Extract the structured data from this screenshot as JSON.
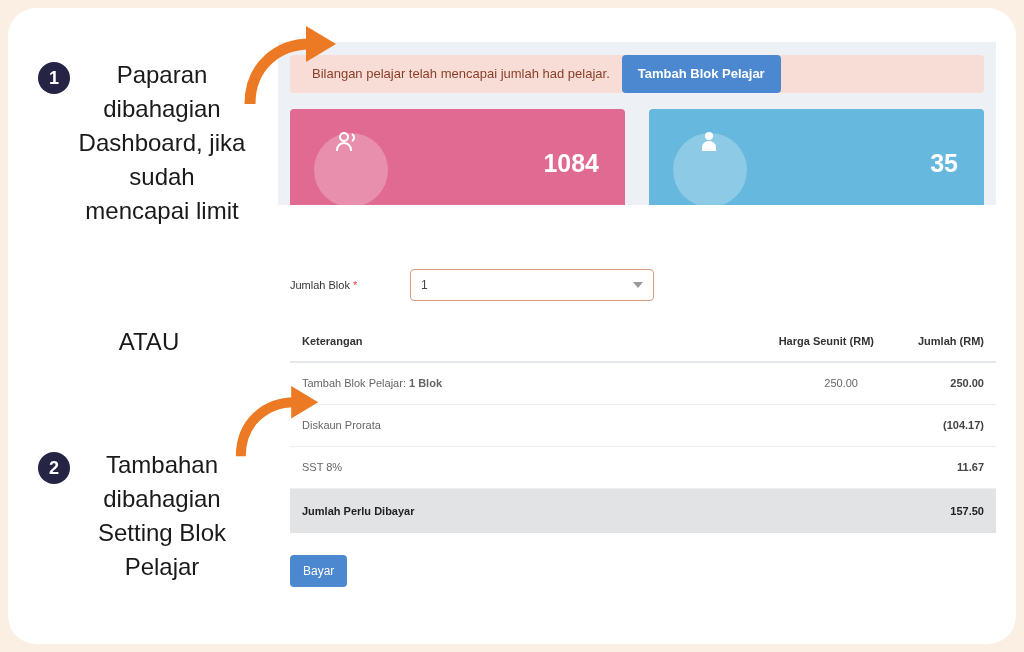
{
  "steps": [
    {
      "number": "1",
      "caption": "Paparan dibahagian Dashboard, jika sudah mencapai limit"
    },
    {
      "number": "2",
      "caption": "Tambahan dibahagian Setting Blok Pelajar"
    }
  ],
  "separator": "ATAU",
  "dashboard": {
    "alert": {
      "message": "Bilangan pelajar telah mencapai jumlah had pelajar.",
      "button": "Tambah Blok Pelajar"
    },
    "stats": [
      {
        "value": "1084",
        "color": "#e06a92"
      },
      {
        "value": "35",
        "color": "#66b8de"
      }
    ]
  },
  "form": {
    "field": {
      "label": "Jumlah Blok",
      "required_mark": "*",
      "value": "1"
    },
    "table": {
      "columns": [
        "Keterangan",
        "Harga Seunit (RM)",
        "Jumlah (RM)"
      ],
      "rows": [
        {
          "description": "Tambah Blok Pelajar: **1 Blok**",
          "unit_price": "250.00",
          "amount": "250.00",
          "total": false
        },
        {
          "description": "Diskaun Prorata",
          "amount": "(104.17)",
          "total": false
        },
        {
          "description": "SST 8%",
          "amount": "11.67",
          "total": false
        },
        {
          "description": "Jumlah Perlu Dibayar",
          "amount": "157.50",
          "total": true
        }
      ]
    },
    "pay_button": "Bayar"
  }
}
